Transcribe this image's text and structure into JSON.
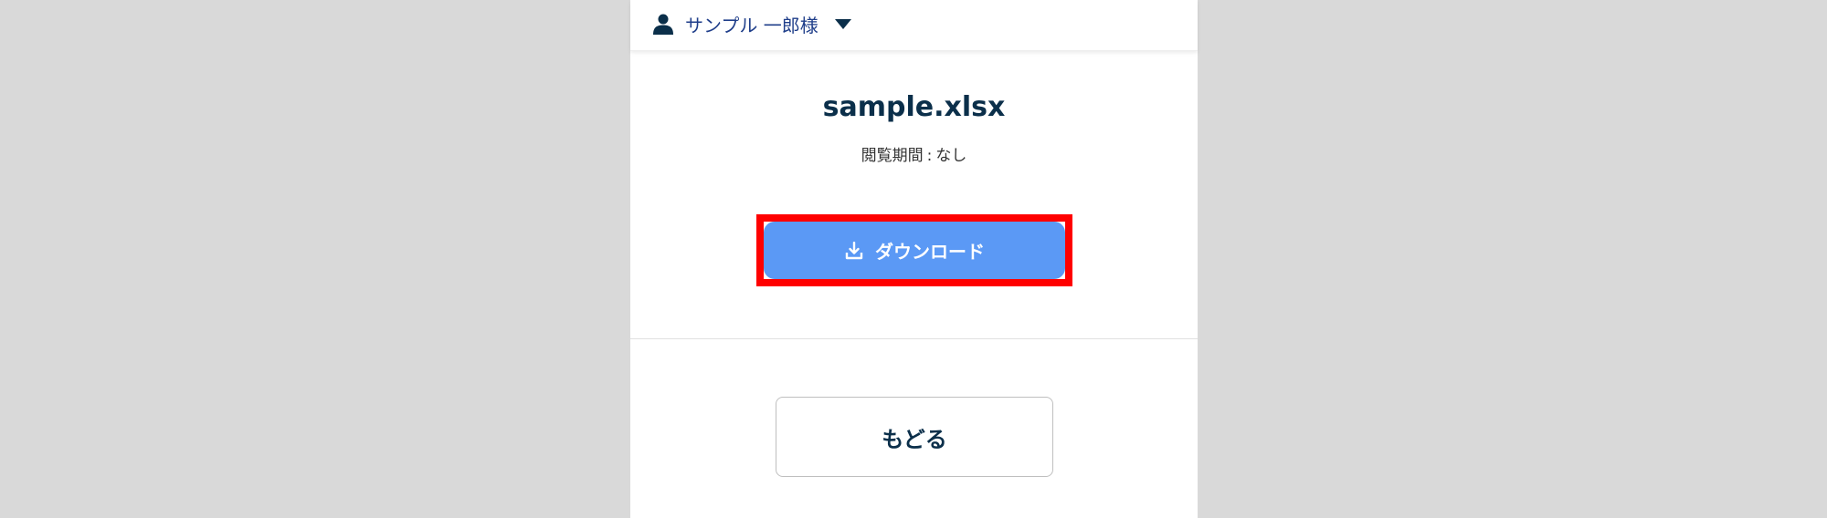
{
  "header": {
    "user_name": "サンプル 一郎様",
    "user_icon": "user-icon",
    "menu_icon": "caret-down-icon"
  },
  "file": {
    "name": "sample.xlsx",
    "period_label": "閲覧期間",
    "period_separator": ":",
    "period_value": "なし"
  },
  "actions": {
    "download_label": "ダウンロード",
    "download_icon": "download-icon",
    "back_label": "もどる"
  },
  "colors": {
    "page_background": "#d9d9d9",
    "panel_background": "#ffffff",
    "primary_button": "#5b99f5",
    "highlight_border": "#ff0000",
    "heading_text": "#0b2f4a",
    "user_text": "#1f3e8a"
  }
}
